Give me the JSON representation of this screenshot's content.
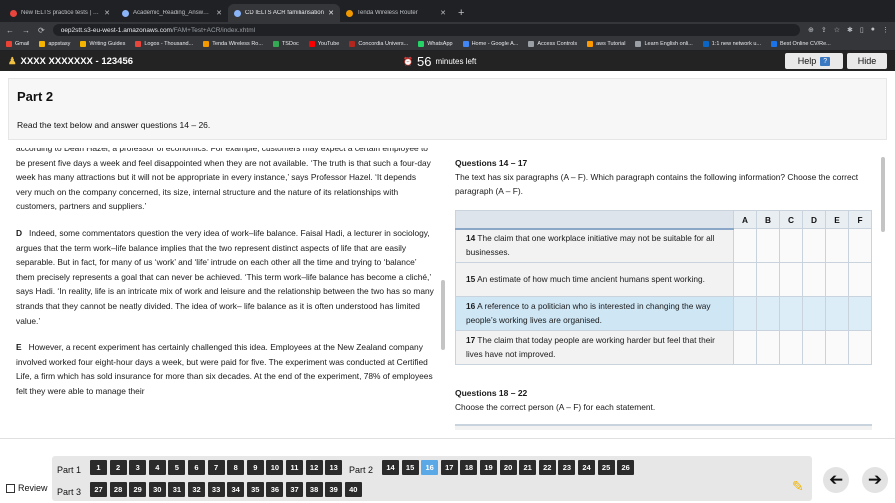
{
  "browser": {
    "tabs": [
      {
        "title": "New IELTS practice tests | IDP",
        "color": "#e8453c"
      },
      {
        "title": "Academic_Reading_Answer_l",
        "color": "#8ab4f8"
      },
      {
        "title": "CD IELTS ACR familiarisation",
        "color": "#8ab4f8"
      },
      {
        "title": "Tenda Wireless Router",
        "color": "#f29900"
      }
    ],
    "url_host": "oep2stt.s3-eu-west-1.amazonaws.com",
    "url_path": "/FAM+Test+ACR/index.xhtml",
    "bookmarks": [
      {
        "label": "Gmail",
        "color": "#ea4335"
      },
      {
        "label": "appstasy",
        "color": "#f4b400"
      },
      {
        "label": "Writing Guides",
        "color": "#f4b400"
      },
      {
        "label": "Logos - Thousand...",
        "color": "#e8453c"
      },
      {
        "label": "Tenda Wireless Ro...",
        "color": "#f29900"
      },
      {
        "label": "TSDoc",
        "color": "#34a853"
      },
      {
        "label": "YouTube",
        "color": "#ff0000"
      },
      {
        "label": "Concordia Univers...",
        "color": "#b3261e"
      },
      {
        "label": "WhatsApp",
        "color": "#25d366"
      },
      {
        "label": "Home - Google A...",
        "color": "#4285f4"
      },
      {
        "label": "Access Controls",
        "color": "#9aa0a6"
      },
      {
        "label": "aws Tutorial",
        "color": "#ff9900"
      },
      {
        "label": "Learn English onli...",
        "color": "#9aa0a6"
      },
      {
        "label": "1:1 new network u...",
        "color": "#0a66c2"
      },
      {
        "label": "Best Online CV/Re...",
        "color": "#1a73e8"
      }
    ]
  },
  "exam": {
    "candidate": "XXXX XXXXXXX - 123456",
    "timer_value": "56",
    "timer_unit": "minutes left",
    "help_label": "Help",
    "hide_label": "Hide"
  },
  "part": {
    "title": "Part 2",
    "instruction": "Read the text below and answer questions 14 – 26."
  },
  "passage": {
    "p_cont": "according to Dean Hazel, a professor of economics. For example, customers may expect a certain employee to be present five days a week and feel disappointed when they are not available. ‘The truth is that such a four-day week has many attractions but it will not be appropriate in every instance,’ says Professor Hazel. ‘It depends very much on the company concerned, its size, internal structure and the nature of its relationships with customers, partners and suppliers.’",
    "pD_letter": "D",
    "pD": "Indeed, some commentators question the very idea of work–life balance. Faisal Hadi, a lecturer in sociology, argues that the term work–life balance implies that the two represent distinct aspects of life that are easily separable. But in fact, for many of us ‘work’ and ‘life’ intrude on each other all the time and trying to ‘balance’ them precisely represents a goal that can never be achieved. ‘This term work–life balance has become a cliché,’ says Hadi. ‘In reality, life is an intricate mix of work and leisure and the relationship between the two has so many strands that they cannot be neatly divided. The idea of work– life balance as it is often understood has limited value.’",
    "pE_letter": "E",
    "pE": "However, a recent experiment has certainly challenged this idea. Employees at the New Zealand company involved worked four eight-hour days a week, but were paid for five. The experiment was conducted at Certified Life, a firm which has sold insurance for more than six decades. At the end of the experiment, 78% of employees felt they were able to manage their"
  },
  "questions": {
    "g1_heading": "Questions 14 – 17",
    "g1_instr": "The text has six paragraphs (A – F). Which paragraph contains the following information? Choose the correct paragraph (A – F).",
    "options": [
      "A",
      "B",
      "C",
      "D",
      "E",
      "F"
    ],
    "items": [
      {
        "num": "14",
        "text": "The claim that one workplace initiative may not be suitable for all businesses."
      },
      {
        "num": "15",
        "text": "An estimate of how much time ancient humans spent working."
      },
      {
        "num": "16",
        "text": "A reference to a politician who is interested in changing the way people’s working lives are organised."
      },
      {
        "num": "17",
        "text": "The claim that today people are working harder but feel that their lives have not improved."
      }
    ],
    "selected_item": "16",
    "g2_heading": "Questions 18 – 22",
    "g2_instr": "Choose the correct person (A – F) for each statement."
  },
  "footer": {
    "part1_label": "Part 1",
    "part2_label": "Part 2",
    "part3_label": "Part 3",
    "part1_nums": [
      "1",
      "2",
      "3",
      "4",
      "5",
      "6",
      "7",
      "8",
      "9",
      "10",
      "11",
      "12",
      "13"
    ],
    "part2_nums": [
      "14",
      "15",
      "16",
      "17",
      "18",
      "19",
      "20",
      "21",
      "22",
      "23",
      "24",
      "25",
      "26"
    ],
    "part3_nums": [
      "27",
      "28",
      "29",
      "30",
      "31",
      "32",
      "33",
      "34",
      "35",
      "36",
      "37",
      "38",
      "39",
      "40"
    ],
    "current": "16",
    "review_label": "Review"
  }
}
